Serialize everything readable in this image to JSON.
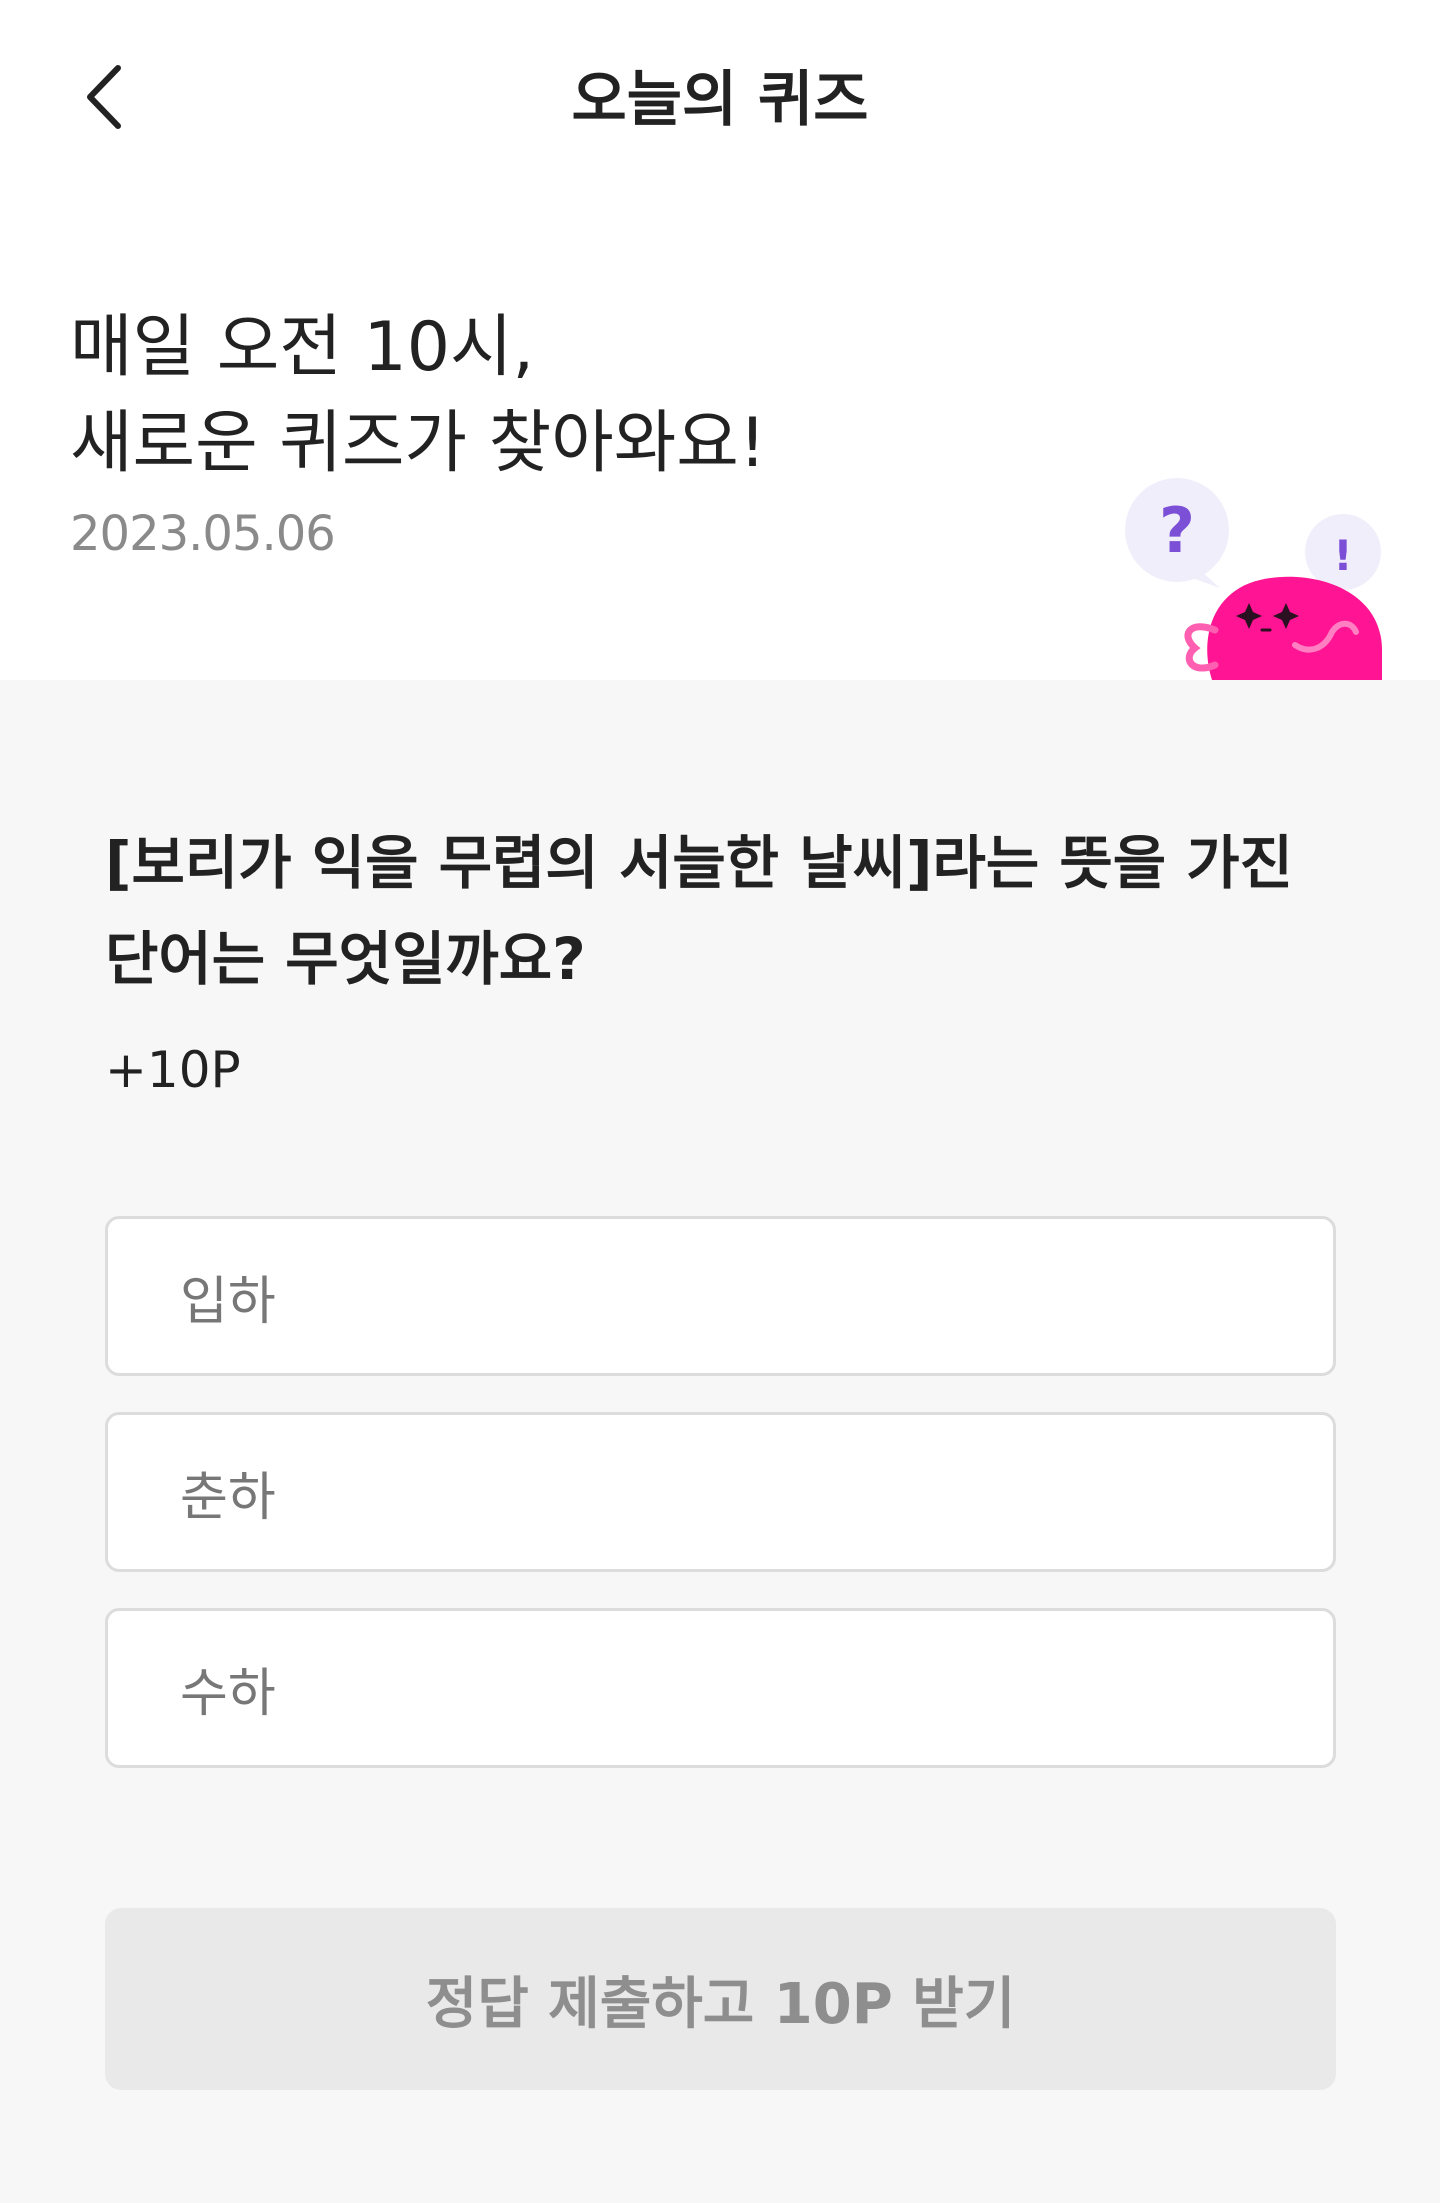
{
  "header": {
    "title": "오늘의 퀴즈",
    "back_icon": "chevron-left-icon"
  },
  "intro": {
    "line1": "매일 오전 10시,",
    "line2": "새로운 퀴즈가 찾아와요!",
    "date": "2023.05.06"
  },
  "mascot": {
    "question_mark": "?",
    "exclaim_mark": "!",
    "body_color": "#ff1493",
    "bubble_color": "#f1eefb",
    "mark_color": "#7b4fd6"
  },
  "quiz": {
    "question_line1": "[보리가 익을 무렵의 서늘한 날씨]라는 뜻을 가진",
    "question_line2": "단어는 무엇일까요?",
    "points": "+10P",
    "options": [
      {
        "label": "입하"
      },
      {
        "label": "춘하"
      },
      {
        "label": "수하"
      }
    ],
    "submit_label": "정답 제출하고 10P 받기"
  }
}
